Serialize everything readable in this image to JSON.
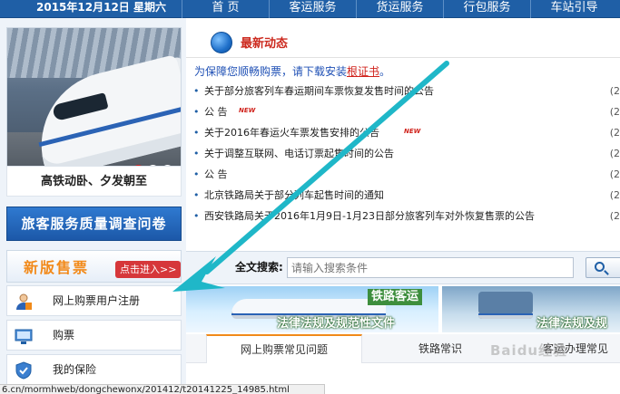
{
  "topbar": {
    "date": "2015年12月12日  星期六",
    "nav": [
      {
        "label": "首  页"
      },
      {
        "label": "客运服务"
      },
      {
        "label": "货运服务"
      },
      {
        "label": "行包服务"
      },
      {
        "label": "车站引导"
      }
    ]
  },
  "sidebar": {
    "banner_pager": [
      "1",
      "2",
      "3"
    ],
    "banner_active_index": 1,
    "banner_caption": "高铁动卧、夕发朝至",
    "survey_button": "旅客服务质量调查问卷",
    "new_sale_title": "新版售票",
    "new_sale_enter": "点击进入>>",
    "menu": [
      {
        "label": "网上购票用户注册",
        "icon": "user-register-icon"
      },
      {
        "label": "购票",
        "icon": "ticket-screen-icon"
      },
      {
        "label": "我的保险",
        "icon": "insurance-shield-icon"
      }
    ]
  },
  "news": {
    "title": "最新动态",
    "notice_prefix": "为保障您顺畅购票，请下载安装",
    "notice_link": "根证书",
    "notice_suffix": "。",
    "new_badge": "NEW",
    "items": [
      {
        "text": "关于部分旅客列车春运期间车票恢复发售时间的公告",
        "date": "(2",
        "is_new": false
      },
      {
        "text": "公 告",
        "date": "(2",
        "is_new": true
      },
      {
        "text": "关于2016年春运火车票发售安排的公告",
        "date": "(2",
        "is_new": true
      },
      {
        "text": "关于调整互联网、电话订票起售时间的公告",
        "date": "(2",
        "is_new": false
      },
      {
        "text": "公 告",
        "date": "(2",
        "is_new": false
      },
      {
        "text": "北京铁路局关于部分列车起售时间的通知",
        "date": "(2",
        "is_new": false
      },
      {
        "text": "西安铁路局关于2016年1月9日-1月23日部分旅客列车对外恢复售票的公告",
        "date": "(2",
        "is_new": false
      }
    ]
  },
  "search": {
    "label": "全文搜索:",
    "placeholder": "请输入搜索条件"
  },
  "law_banners": [
    {
      "tag": "铁路客运",
      "title": "法律法规及规范性文件"
    },
    {
      "tag": "",
      "title": "法律法规及规"
    }
  ],
  "tabs": [
    {
      "label": "网上购票常见问题",
      "active": true
    },
    {
      "label": "铁路常识",
      "active": false
    },
    {
      "label": "客运办理常见",
      "active": false
    }
  ],
  "status_bar": {
    "url": "6.cn/mormhweb/dongchewonx/201412/t20141225_14985.html"
  },
  "annotation": {
    "arrow_color": "#1fb7c8"
  },
  "watermark": "Baidu经验",
  "colors": {
    "nav_blue": "#1f5fa6",
    "accent_red": "#cc2a1f",
    "accent_orange": "#f28a1a",
    "link_blue": "#1f50b5"
  }
}
